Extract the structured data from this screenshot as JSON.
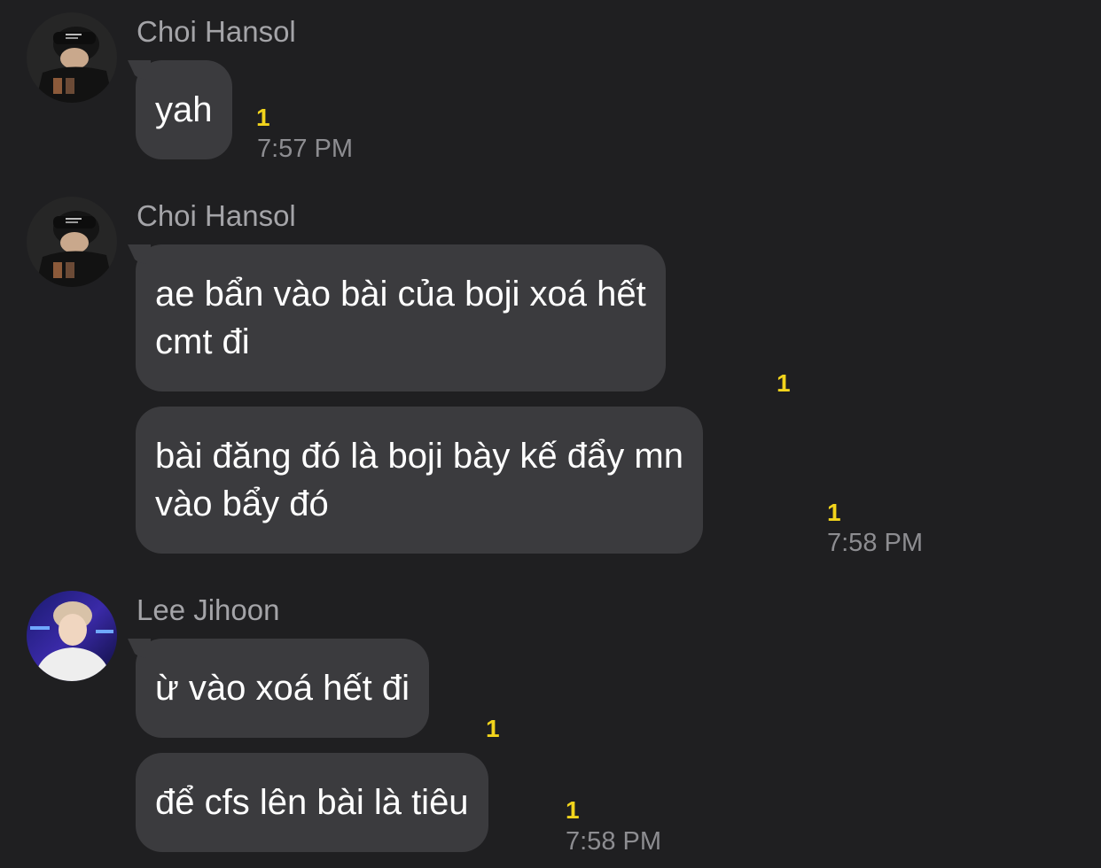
{
  "colors": {
    "background": "#1f1f21",
    "bubble": "#3b3b3e",
    "sender_name": "#a4a4a8",
    "unread_count": "#f2d41c",
    "timestamp": "#8d8d91"
  },
  "groups": [
    {
      "sender": "Choi Hansol",
      "avatar_icon": "user-avatar-photo",
      "messages": [
        {
          "text": "yah",
          "unread": "1",
          "time": "7:57 PM"
        }
      ]
    },
    {
      "sender": "Choi Hansol",
      "avatar_icon": "user-avatar-photo",
      "messages": [
        {
          "lines": [
            "ae bẩn vào bài của boji xoá hết",
            "cmt đi"
          ],
          "unread": "1",
          "time": ""
        },
        {
          "lines": [
            "bài đăng đó là boji bày kế đẩy mn",
            "vào bẩy đó"
          ],
          "unread": "1",
          "time": "7:58 PM"
        }
      ]
    },
    {
      "sender": "Lee Jihoon",
      "avatar_icon": "user-avatar-photo",
      "messages": [
        {
          "text": "ừ vào xoá hết đi",
          "unread": "1",
          "time": ""
        },
        {
          "text": "để cfs lên bài là tiêu",
          "unread": "1",
          "time": "7:58 PM"
        }
      ]
    }
  ]
}
